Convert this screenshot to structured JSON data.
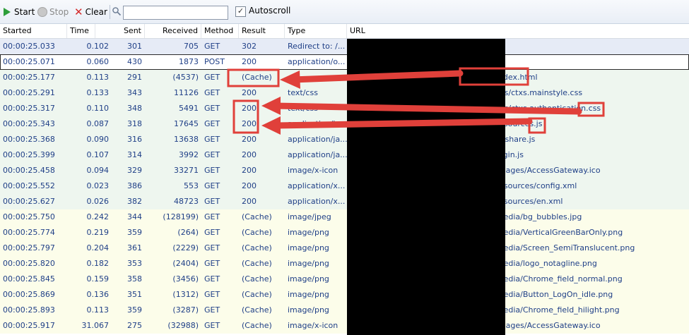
{
  "toolbar": {
    "start_label": "Start",
    "stop_label": "Stop",
    "clear_label": "Clear",
    "search_value": "",
    "autoscroll_label": "Autoscroll",
    "autoscroll_checked": "✓"
  },
  "columns": [
    "Started",
    "Time",
    "Sent",
    "Received",
    "Method",
    "Result",
    "Type",
    "URL"
  ],
  "rows": [
    {
      "started": "00:00:25.033",
      "time": "0.102",
      "sent": "301",
      "received": "705",
      "method": "GET",
      "result": "302",
      "type": "Redirect to: /...",
      "url": "",
      "bg": "#e6ebf6"
    },
    {
      "started": "00:00:25.071",
      "time": "0.060",
      "sent": "430",
      "received": "1873",
      "method": "POST",
      "result": "200",
      "type": "application/o...",
      "url": "",
      "bg": "#ffffff"
    },
    {
      "started": "00:00:25.177",
      "time": "0.113",
      "sent": "291",
      "received": "(4537)",
      "method": "GET",
      "result": "(Cache)",
      "type": "",
      "url": "/vpn/index.html",
      "bg": "#eef6ef"
    },
    {
      "started": "00:00:25.291",
      "time": "0.133",
      "sent": "343",
      "received": "11126",
      "method": "GET",
      "result": "200",
      "type": "text/css",
      "url": "/vpn/css/ctxs.mainstyle.css",
      "bg": "#eef6ef"
    },
    {
      "started": "00:00:25.317",
      "time": "0.110",
      "sent": "348",
      "received": "5491",
      "method": "GET",
      "result": "200",
      "type": "text/css",
      "url": "/vpn/css/ctxs.authentication.css",
      "bg": "#eef6ef"
    },
    {
      "started": "00:00:25.343",
      "time": "0.087",
      "sent": "318",
      "received": "17645",
      "method": "GET",
      "result": "200",
      "type": "application/ja...",
      "url": "/vpn/resources.js",
      "bg": "#eef6ef"
    },
    {
      "started": "00:00:25.368",
      "time": "0.090",
      "sent": "316",
      "received": "13638",
      "method": "GET",
      "result": "200",
      "type": "application/ja...",
      "url": "/vpn/nsshare.js",
      "bg": "#eef6ef"
    },
    {
      "started": "00:00:25.399",
      "time": "0.107",
      "sent": "314",
      "received": "3992",
      "method": "GET",
      "result": "200",
      "type": "application/ja...",
      "url": "/vpn/login.js",
      "bg": "#eef6ef"
    },
    {
      "started": "00:00:25.458",
      "time": "0.094",
      "sent": "329",
      "received": "33271",
      "method": "GET",
      "result": "200",
      "type": "image/x-icon",
      "url": "/vpn/images/AccessGateway.ico",
      "bg": "#eef6ef"
    },
    {
      "started": "00:00:25.552",
      "time": "0.023",
      "sent": "386",
      "received": "553",
      "method": "GET",
      "result": "200",
      "type": "application/x...",
      "url": "/vpn/resources/config.xml",
      "bg": "#eef6ef"
    },
    {
      "started": "00:00:25.627",
      "time": "0.026",
      "sent": "382",
      "received": "48723",
      "method": "GET",
      "result": "200",
      "type": "application/x...",
      "url": "/vpn/resources/en.xml",
      "bg": "#eef6ef"
    },
    {
      "started": "00:00:25.750",
      "time": "0.242",
      "sent": "344",
      "received": "(128199)",
      "method": "GET",
      "result": "(Cache)",
      "type": "image/jpeg",
      "url": "/vpn/media/bg_bubbles.jpg",
      "bg": "#fcfdea"
    },
    {
      "started": "00:00:25.774",
      "time": "0.219",
      "sent": "359",
      "received": "(264)",
      "method": "GET",
      "result": "(Cache)",
      "type": "image/png",
      "url": "/vpn/media/VerticalGreenBarOnly.png",
      "bg": "#fcfdea"
    },
    {
      "started": "00:00:25.797",
      "time": "0.204",
      "sent": "361",
      "received": "(2229)",
      "method": "GET",
      "result": "(Cache)",
      "type": "image/png",
      "url": "/vpn/media/Screen_SemiTranslucent.png",
      "bg": "#fcfdea"
    },
    {
      "started": "00:00:25.820",
      "time": "0.182",
      "sent": "353",
      "received": "(2404)",
      "method": "GET",
      "result": "(Cache)",
      "type": "image/png",
      "url": "/vpn/media/logo_notagline.png",
      "bg": "#fcfdea"
    },
    {
      "started": "00:00:25.845",
      "time": "0.159",
      "sent": "358",
      "received": "(3456)",
      "method": "GET",
      "result": "(Cache)",
      "type": "image/png",
      "url": "/vpn/media/Chrome_field_normal.png",
      "bg": "#fcfdea"
    },
    {
      "started": "00:00:25.869",
      "time": "0.136",
      "sent": "351",
      "received": "(1312)",
      "method": "GET",
      "result": "(Cache)",
      "type": "image/png",
      "url": "/vpn/media/Button_LogOn_idle.png",
      "bg": "#fcfdea"
    },
    {
      "started": "00:00:25.893",
      "time": "0.113",
      "sent": "359",
      "received": "(3287)",
      "method": "GET",
      "result": "(Cache)",
      "type": "image/png",
      "url": "/vpn/media/Chrome_field_hilight.png",
      "bg": "#fcfdea"
    },
    {
      "started": "00:00:25.917",
      "time": "31.067",
      "sent": "275",
      "received": "(32988)",
      "method": "GET",
      "result": "(Cache)",
      "type": "image/x-icon",
      "url": "/vpn/images/AccessGateway.ico",
      "bg": "#fcfdea"
    }
  ],
  "colors": {
    "row_text": "#1f3f87",
    "annotation_red": "#e0403a"
  }
}
